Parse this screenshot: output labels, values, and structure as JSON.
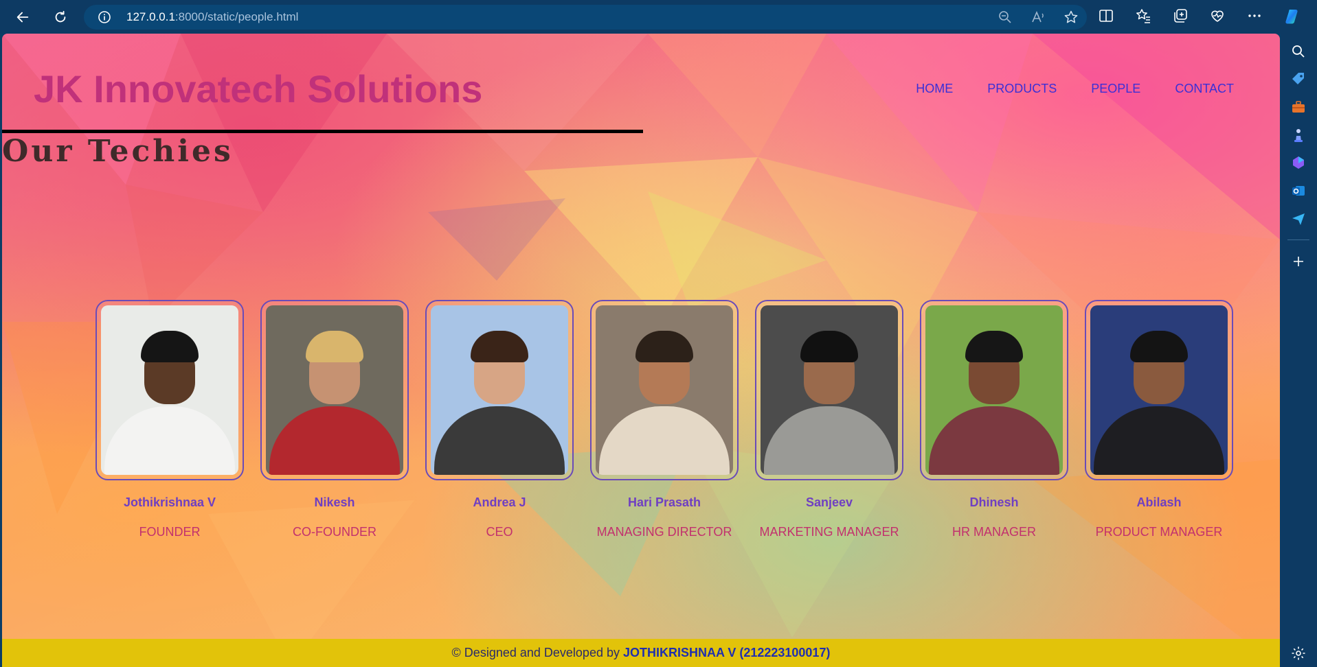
{
  "browser": {
    "url_host": "127.0.0.1",
    "url_rest": ":8000/static/people.html",
    "icons": {
      "back": "back-arrow-icon",
      "refresh": "refresh-icon",
      "info": "info-icon",
      "zoom": "zoom-out-icon",
      "read_aloud": "read-aloud-icon",
      "favorite": "star-icon",
      "split": "split-screen-icon",
      "favorites": "favorites-icon",
      "collections": "collections-icon",
      "health": "browser-essentials-icon",
      "more": "more-icon",
      "copilot": "copilot-icon"
    },
    "sidebar_icons": [
      "search-icon",
      "tag-icon",
      "briefcase-icon",
      "chess-icon",
      "m365-icon",
      "outlook-icon",
      "send-icon",
      "add-icon",
      "settings-icon"
    ]
  },
  "site": {
    "brand": "JK Innovatech Solutions",
    "nav": [
      "HOME",
      "PRODUCTS",
      "PEOPLE",
      "CONTACT"
    ],
    "heading": "Our Techies"
  },
  "team": [
    {
      "name": "Jothikrishnaa V",
      "role": "FOUNDER"
    },
    {
      "name": "Nikesh",
      "role": "CO-FOUNDER"
    },
    {
      "name": "Andrea J",
      "role": "CEO"
    },
    {
      "name": "Hari Prasath",
      "role": "MANAGING DIRECTOR"
    },
    {
      "name": "Sanjeev",
      "role": "MARKETING MANAGER"
    },
    {
      "name": "Dhinesh",
      "role": "HR MANAGER"
    },
    {
      "name": "Abilash",
      "role": "PRODUCT MANAGER"
    }
  ],
  "footer": {
    "prefix": "© Designed and Developed by ",
    "author": "JOTHIKRISHNAA V (212223100017)"
  },
  "colors": {
    "brand": "#c0317a",
    "nav": "#3b2fd6",
    "name": "#6f3fc2",
    "role": "#c2306e",
    "footer_bg": "#e2c30a"
  }
}
